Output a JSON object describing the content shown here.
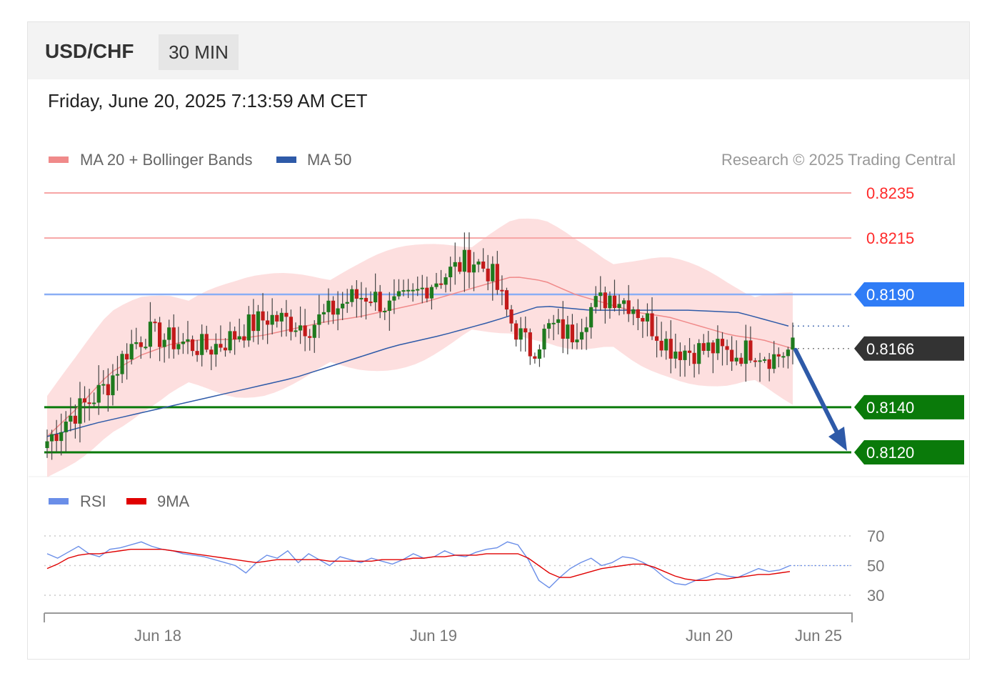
{
  "header": {
    "symbol": "USD/CHF",
    "timeframe": "30 MIN"
  },
  "timestamp": "Friday, June 20, 2025 7:13:59 AM CET",
  "legend": {
    "ma20": {
      "label": "MA 20 + Bollinger Bands",
      "color": "#f08a8a"
    },
    "ma50": {
      "label": "MA 50",
      "color": "#2e5aa8"
    },
    "copyright": "Research © 2025 Trading Central"
  },
  "rsi_legend": {
    "rsi": {
      "label": "RSI",
      "color": "#6a8ee8"
    },
    "ma9": {
      "label": "9MA",
      "color": "#e00000"
    }
  },
  "colors": {
    "resistance": "#ff2a2a",
    "pivot": "#2f7cf6",
    "support": "#0a7a0a",
    "last": "#333333",
    "arrow": "#2e5aa8",
    "candle_up": "#1e7a1e",
    "candle_down": "#c21a1a"
  },
  "chart_data": [
    {
      "type": "line",
      "title": "USD/CHF",
      "ylim": [
        0.8112,
        0.8245
      ],
      "x_tick_labels": [
        "Jun 18",
        "Jun 19",
        "Jun 20",
        "Jun 25"
      ],
      "levels": [
        {
          "label": "0.8235",
          "value": 0.8235,
          "kind": "resistance"
        },
        {
          "label": "0.8215",
          "value": 0.8215,
          "kind": "resistance"
        },
        {
          "label": "0.8190",
          "value": 0.819,
          "kind": "pivot"
        },
        {
          "label": "0.8166",
          "value": 0.8166,
          "kind": "last"
        },
        {
          "label": "0.8140",
          "value": 0.814,
          "kind": "support"
        },
        {
          "label": "0.8120",
          "value": 0.812,
          "kind": "support"
        }
      ],
      "anchors": [
        0.8125,
        0.8135,
        0.8142,
        0.815,
        0.8166,
        0.8173,
        0.817,
        0.8168,
        0.8166,
        0.817,
        0.8176,
        0.818,
        0.8178,
        0.8176,
        0.8182,
        0.8188,
        0.819,
        0.8184,
        0.8188,
        0.8195,
        0.82,
        0.8206,
        0.82,
        0.8178,
        0.8165,
        0.8176,
        0.8172,
        0.8184,
        0.819,
        0.8186,
        0.8176,
        0.8166,
        0.8165,
        0.8166,
        0.8163,
        0.8166,
        0.8162,
        0.8166
      ],
      "ma20_anchors": [
        0.8127,
        0.814,
        0.8155,
        0.8163,
        0.8168,
        0.817,
        0.817,
        0.8172,
        0.8175,
        0.8178,
        0.818,
        0.8183,
        0.8186,
        0.819,
        0.8194,
        0.8198,
        0.8196,
        0.819,
        0.8186,
        0.8182,
        0.818,
        0.8176,
        0.8172,
        0.817,
        0.8166
      ],
      "ma50_anchors": [
        0.8127,
        0.8133,
        0.8138,
        0.8143,
        0.8148,
        0.8153,
        0.816,
        0.8167,
        0.8172,
        0.8178,
        0.8185,
        0.8183,
        0.8183,
        0.8183,
        0.8182,
        0.8176
      ],
      "series": [
        {
          "name": "MA 20 + Bollinger Bands"
        },
        {
          "name": "MA 50"
        }
      ],
      "forecast": {
        "from": 0.8166,
        "to": 0.812
      }
    },
    {
      "type": "line",
      "title": "RSI",
      "ylim": [
        25,
        75
      ],
      "y_tick_labels": [
        "70",
        "50",
        "30"
      ],
      "x_tick_labels": [
        "Jun 18",
        "Jun 19",
        "Jun 20",
        "Jun 25"
      ],
      "series": [
        {
          "name": "RSI",
          "values": [
            58,
            55,
            59,
            63,
            58,
            56,
            61,
            62,
            64,
            66,
            63,
            61,
            60,
            58,
            57,
            56,
            54,
            52,
            50,
            45,
            52,
            57,
            55,
            60,
            52,
            58,
            54,
            50,
            56,
            54,
            52,
            55,
            53,
            51,
            54,
            58,
            55,
            56,
            60,
            57,
            56,
            59,
            61,
            62,
            66,
            64,
            54,
            40,
            35,
            42,
            48,
            52,
            55,
            50,
            52,
            56,
            55,
            52,
            48,
            42,
            38,
            37,
            40,
            42,
            45,
            43,
            42,
            45,
            48,
            46,
            47,
            50
          ]
        },
        {
          "name": "9MA",
          "values": [
            48,
            51,
            55,
            57,
            58,
            58,
            59,
            60,
            61,
            61,
            61,
            61,
            60,
            59,
            58,
            57,
            56,
            55,
            54,
            53,
            52,
            53,
            54,
            54,
            54,
            54,
            54,
            53,
            53,
            53,
            53,
            53,
            54,
            54,
            54,
            55,
            55,
            56,
            56,
            57,
            57,
            57,
            58,
            58,
            58,
            58,
            55,
            50,
            45,
            42,
            42,
            44,
            46,
            48,
            49,
            50,
            51,
            51,
            49,
            46,
            43,
            41,
            40,
            40,
            41,
            41,
            42,
            43,
            44,
            44,
            45,
            46
          ]
        }
      ]
    }
  ]
}
